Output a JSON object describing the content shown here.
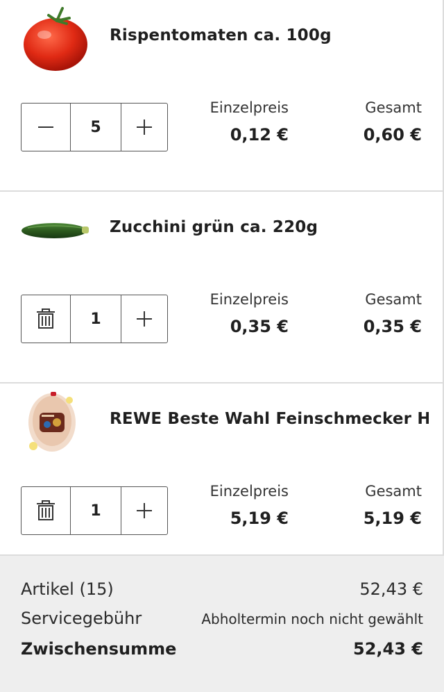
{
  "cart": {
    "unit_price_label": "Einzelpreis",
    "total_label": "Gesamt",
    "items": [
      {
        "name": "Rispentomaten ca. 100g",
        "quantity": "5",
        "left_control": "decrease-button",
        "unit_price": "0,12 €",
        "total": "0,60 €"
      },
      {
        "name": "Zucchini grün ca. 220g",
        "quantity": "1",
        "left_control": "delete-button",
        "unit_price": "0,35 €",
        "total": "0,35 €"
      },
      {
        "name": "REWE Beste Wahl Feinschmecker Hä...",
        "quantity": "1",
        "left_control": "delete-button",
        "unit_price": "5,19 €",
        "total": "5,19 €"
      }
    ]
  },
  "summary": {
    "articles_label": "Artikel (15)",
    "articles_value": "52,43 €",
    "service_fee_label": "Servicegebühr",
    "service_fee_value": "Abholtermin noch nicht gewählt",
    "subtotal_label": "Zwischensumme",
    "subtotal_value": "52,43 €"
  },
  "icons": {
    "minus": "minus-icon",
    "plus": "plus-icon",
    "trash": "trash-icon"
  }
}
